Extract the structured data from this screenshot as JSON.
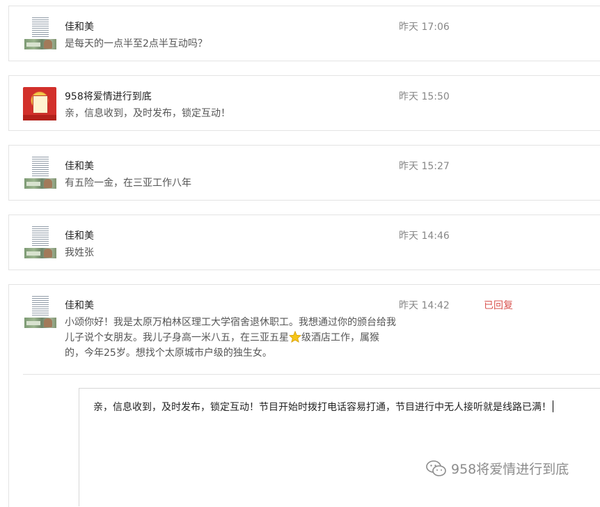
{
  "messages": [
    {
      "name": "佳和美",
      "text": "是每天的一点半至2点半互动吗？",
      "time": "昨天 17:06",
      "avatar": "document-avatar"
    },
    {
      "name": "958将爱情进行到底",
      "text": "亲，信息收到，及时发布，锁定互动！",
      "time": "昨天 15:50",
      "avatar": "red-poster-avatar"
    },
    {
      "name": "佳和美",
      "text": "有五险一金，在三亚工作八年",
      "time": "昨天 15:27",
      "avatar": "document-avatar"
    },
    {
      "name": "佳和美",
      "text": "我姓张",
      "time": "昨天 14:46",
      "avatar": "document-avatar"
    },
    {
      "name": "佳和美",
      "text_lines": [
        "小颂你好！我是太原万柏林区理工大学宿舍退休职工。我想通过你的颁台给我",
        "儿子说个女朋友。我儿子身高一米八五，在三亚五星",
        "级酒店工作，属猴",
        "的，今年25岁。想找个太原城市户级的独生女。"
      ],
      "emoji": "star-icon",
      "time": "昨天 14:42",
      "status": "已回复",
      "avatar": "document-avatar"
    }
  ],
  "reply": {
    "text": "亲，信息收到，及时发布，锁定互动！节目开始时拨打电话容易打通，节目进行中无人接听就是线路已满！"
  },
  "watermark": {
    "text": "958将爱情进行到底",
    "icon": "wechat-icon"
  },
  "colors": {
    "status": "#d9534f",
    "border": "#e3e3e3"
  }
}
